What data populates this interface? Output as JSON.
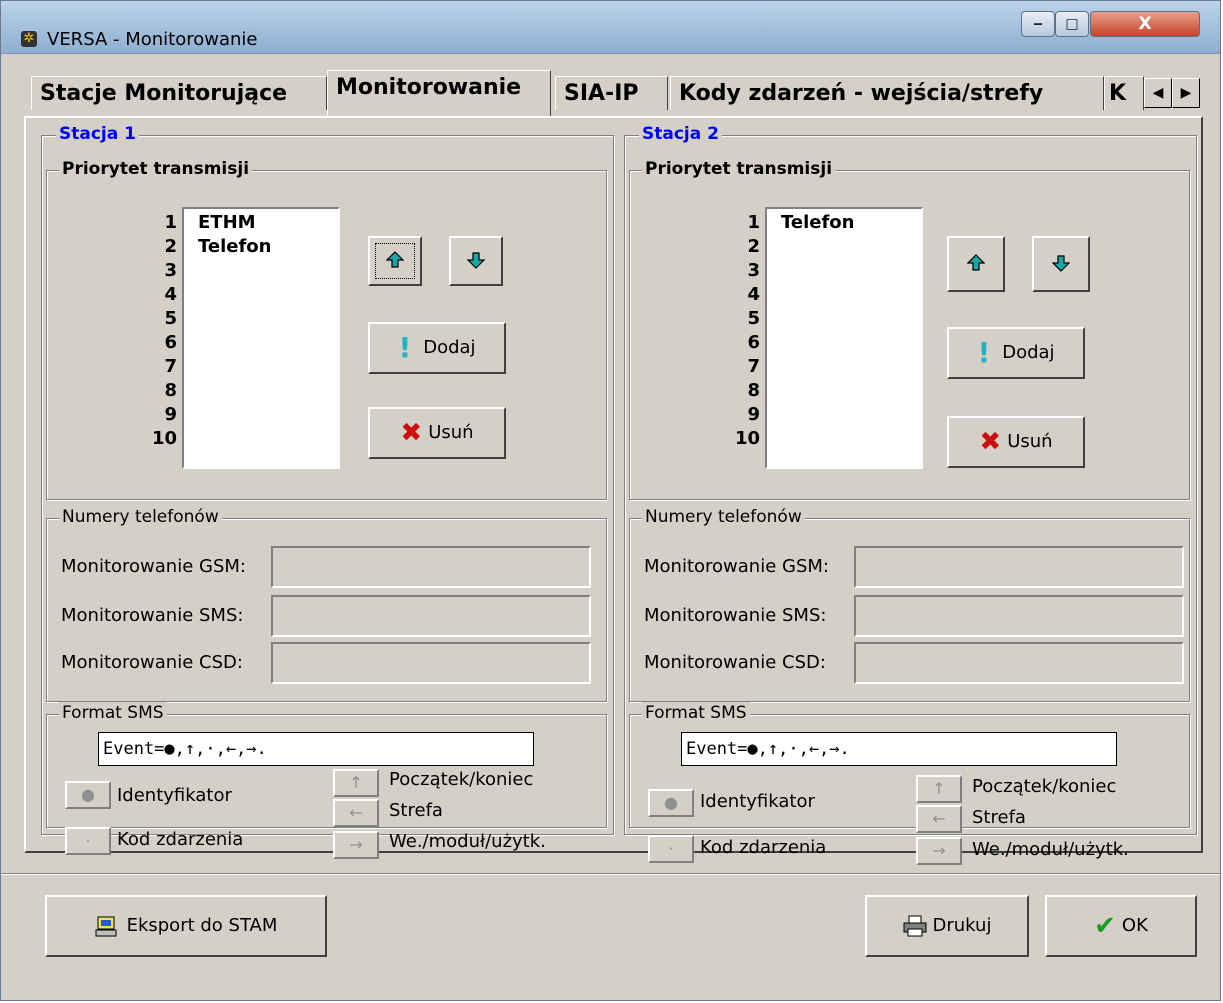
{
  "window": {
    "title": "VERSA - Monitorowanie",
    "minimize": "‒",
    "maximize": "□",
    "close": "X"
  },
  "tabs": [
    {
      "label": "Stacje Monitorujące"
    },
    {
      "label": "Monitorowanie"
    },
    {
      "label": "SIA-IP"
    },
    {
      "label": "Kody zdarzeń - wejścia/strefy"
    },
    {
      "label": "K"
    }
  ],
  "tab_scroll": {
    "left": "◀",
    "right": "▶"
  },
  "stations": [
    {
      "title": "Stacja 1",
      "priority": {
        "title": "Priorytet transmisji",
        "numbers": "1\n2\n3\n4\n5\n6\n7\n8\n9\n10",
        "items": "ETHM\nTelefon",
        "add_label": "Dodaj",
        "remove_label": "Usuń"
      },
      "phones": {
        "title": "Numery telefonów",
        "gsm_label": "Monitorowanie GSM:",
        "gsm_value": "",
        "sms_label": "Monitorowanie SMS:",
        "sms_value": "",
        "csd_label": "Monitorowanie CSD:",
        "csd_value": ""
      },
      "sms": {
        "title": "Format SMS",
        "format": "Event=●,↑,·,←,→.",
        "identifier_label": "Identyfikator",
        "event_code_label": "Kod zdarzenia",
        "start_end_label": "Początek/koniec",
        "zone_label": "Strefa",
        "input_label": "We./moduł/użytk."
      }
    },
    {
      "title": "Stacja 2",
      "priority": {
        "title": "Priorytet transmisji",
        "numbers": "1\n2\n3\n4\n5\n6\n7\n8\n9\n10",
        "items": "Telefon",
        "add_label": "Dodaj",
        "remove_label": "Usuń"
      },
      "phones": {
        "title": "Numery telefonów",
        "gsm_label": "Monitorowanie GSM:",
        "gsm_value": "",
        "sms_label": "Monitorowanie SMS:",
        "sms_value": "",
        "csd_label": "Monitorowanie CSD:",
        "csd_value": ""
      },
      "sms": {
        "title": "Format SMS",
        "format": "Event=●,↑,·,←,→.",
        "identifier_label": "Identyfikator",
        "event_code_label": "Kod zdarzenia",
        "start_end_label": "Początek/koniec",
        "zone_label": "Strefa",
        "input_label": "We./moduł/użytk."
      }
    }
  ],
  "sms_buttons": {
    "dot": "●",
    "mid_dot": "·",
    "up": "↑",
    "left": "←",
    "right": "→"
  },
  "footer": {
    "export_label": "Eksport do STAM",
    "print_label": "Drukuj",
    "ok_label": "OK"
  },
  "colors": {
    "station_title": "#0000ff",
    "arrow_icon": "#1aa7a7",
    "add_icon": "#20b3c8",
    "remove_icon": "#cc1010",
    "ok_icon": "#1f9a1f"
  }
}
